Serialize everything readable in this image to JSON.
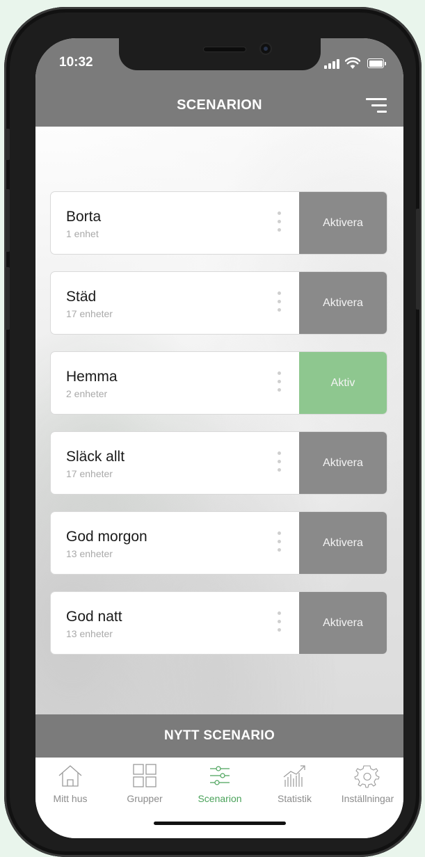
{
  "status_bar": {
    "time": "10:32"
  },
  "header": {
    "title": "SCENARION"
  },
  "scenes": [
    {
      "name": "Borta",
      "devices": "1 enhet",
      "action": "Aktivera",
      "active": false
    },
    {
      "name": "Städ",
      "devices": "17 enheter",
      "action": "Aktivera",
      "active": false
    },
    {
      "name": "Hemma",
      "devices": "2 enheter",
      "action": "Aktiv",
      "active": true
    },
    {
      "name": "Släck allt",
      "devices": "17 enheter",
      "action": "Aktivera",
      "active": false
    },
    {
      "name": "God morgon",
      "devices": "13 enheter",
      "action": "Aktivera",
      "active": false
    },
    {
      "name": "God natt",
      "devices": "13 enheter",
      "action": "Aktivera",
      "active": false
    }
  ],
  "new_scene_button": "NYTT SCENARIO",
  "tabs": [
    {
      "label": "Mitt hus",
      "icon": "house-icon",
      "active": false
    },
    {
      "label": "Grupper",
      "icon": "grid-icon",
      "active": false
    },
    {
      "label": "Scenarion",
      "icon": "sliders-icon",
      "active": true
    },
    {
      "label": "Statistik",
      "icon": "chart-icon",
      "active": false
    },
    {
      "label": "Inställningar",
      "icon": "gear-icon",
      "active": false
    }
  ],
  "colors": {
    "header": "#7b7b7b",
    "action_inactive": "#8a8a8a",
    "action_active": "#8ec78f",
    "tab_active": "#4aa25a"
  }
}
